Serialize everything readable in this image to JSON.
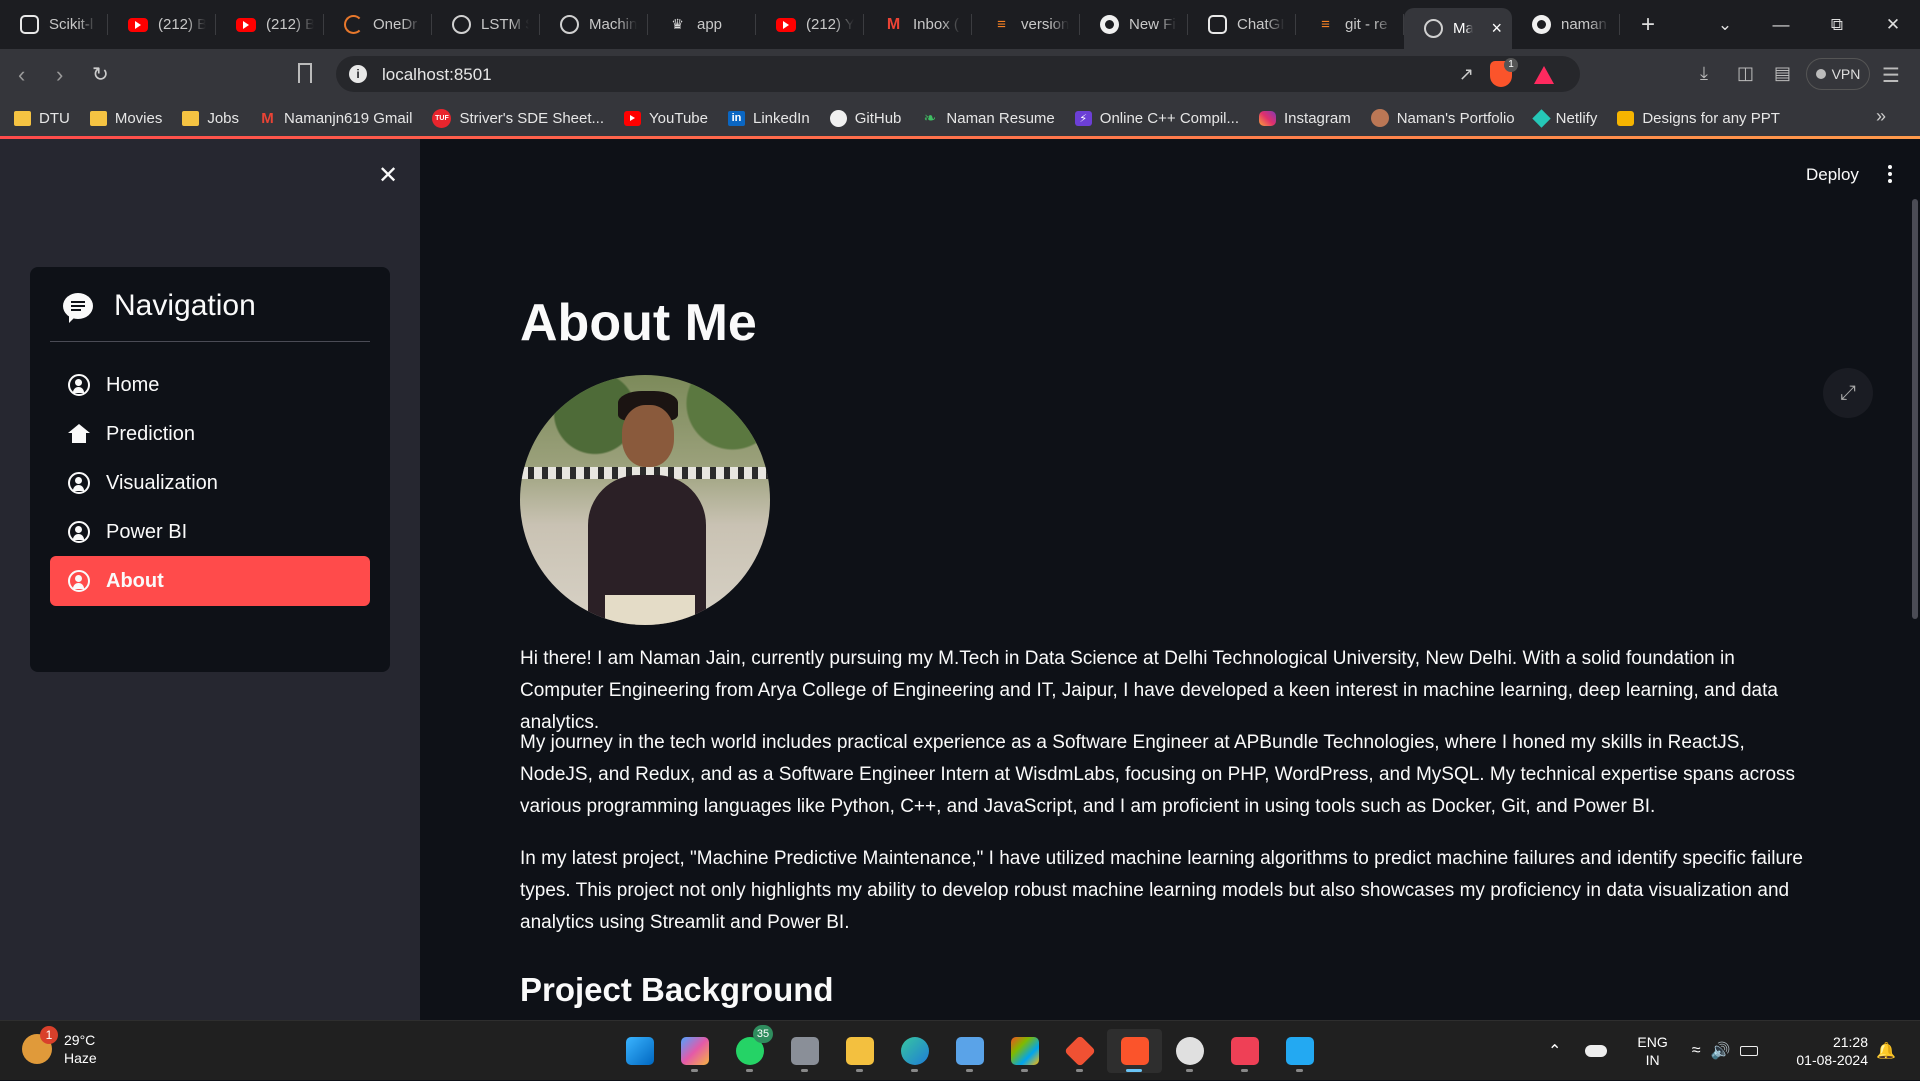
{
  "browser": {
    "tabs": [
      {
        "icon": "openai-icon",
        "label": "Scikit-l"
      },
      {
        "icon": "youtube-icon",
        "label": "(212) B"
      },
      {
        "icon": "youtube-icon",
        "label": "(212) B"
      },
      {
        "icon": "onedrive-icon",
        "label": "OneDr"
      },
      {
        "icon": "globe-icon",
        "label": "LSTM S"
      },
      {
        "icon": "globe-icon",
        "label": "Machin"
      },
      {
        "icon": "streamlit-crown-icon",
        "label": "app"
      },
      {
        "icon": "youtube-icon",
        "label": "(212) Y"
      },
      {
        "icon": "gmail-icon",
        "label": "Inbox ("
      },
      {
        "icon": "stackoverflow-icon",
        "label": "version"
      },
      {
        "icon": "github-icon",
        "label": "New Fi"
      },
      {
        "icon": "openai-icon",
        "label": "ChatGI"
      },
      {
        "icon": "stackoverflow-icon",
        "label": "git - re"
      },
      {
        "icon": "globe-icon",
        "label": "Ma",
        "active": true
      },
      {
        "icon": "github-icon",
        "label": "naman"
      }
    ],
    "new_tab_label": "+",
    "url": "localhost:8501",
    "vpn_label": "VPN",
    "shield_count": "1",
    "bookmarks": [
      {
        "icon": "folder-icon",
        "label": "DTU"
      },
      {
        "icon": "folder-icon",
        "label": "Movies"
      },
      {
        "icon": "folder-icon",
        "label": "Jobs"
      },
      {
        "icon": "gmail-icon",
        "label": "Namanjn619 Gmail"
      },
      {
        "icon": "takeuforward-icon",
        "label": "Striver's SDE Sheet..."
      },
      {
        "icon": "youtube-icon",
        "label": "YouTube"
      },
      {
        "icon": "linkedin-icon",
        "label": "LinkedIn"
      },
      {
        "icon": "github-icon",
        "label": "GitHub"
      },
      {
        "icon": "resume-icon",
        "label": "Naman Resume"
      },
      {
        "icon": "cpp-compiler-icon",
        "label": "Online C++ Compil..."
      },
      {
        "icon": "instagram-icon",
        "label": "Instagram"
      },
      {
        "icon": "portfolio-icon",
        "label": "Naman's Portfolio"
      },
      {
        "icon": "netlify-icon",
        "label": "Netlify"
      },
      {
        "icon": "ppt-folder-icon",
        "label": "Designs for any PPT"
      }
    ]
  },
  "app": {
    "deploy_label": "Deploy",
    "sidebar": {
      "title": "Navigation",
      "items": [
        {
          "label": "Home",
          "icon": "person-circle-icon"
        },
        {
          "label": "Prediction",
          "icon": "house-icon"
        },
        {
          "label": "Visualization",
          "icon": "person-circle-icon"
        },
        {
          "label": "Power BI",
          "icon": "person-circle-icon"
        },
        {
          "label": "About",
          "icon": "person-circle-icon",
          "active": true
        }
      ]
    },
    "main": {
      "title": "About Me",
      "paragraphs": [
        "Hi there! I am Naman Jain, currently pursuing my M.Tech in Data Science at Delhi Technological University, New Delhi. With a solid foundation in Computer Engineering from Arya College of Engineering and IT, Jaipur, I have developed a keen interest in machine learning, deep learning, and data analytics.",
        "My journey in the tech world includes practical experience as a Software Engineer at APBundle Technologies, where I honed my skills in ReactJS, NodeJS, and Redux, and as a Software Engineer Intern at WisdmLabs, focusing on PHP, WordPress, and MySQL. My technical expertise spans across various programming languages like Python, C++, and JavaScript, and I am proficient in using tools such as Docker, Git, and Power BI.",
        "In my latest project, \"Machine Predictive Maintenance,\" I have utilized machine learning algorithms to predict machine failures and identify specific failure types. This project not only highlights my ability to develop robust machine learning models but also showcases my proficiency in data visualization and analytics using Streamlit and Power BI."
      ],
      "section_heading": "Project Background"
    },
    "colors": {
      "accent": "#ff4b4b",
      "sidebar_bg": "#262730",
      "main_bg": "#0e1117"
    }
  },
  "taskbar": {
    "weather": {
      "temp": "29°C",
      "condition": "Haze",
      "badge": "1"
    },
    "apps": [
      {
        "icon": "windows-start-icon"
      },
      {
        "icon": "copilot-icon"
      },
      {
        "icon": "whatsapp-icon",
        "badge": "35"
      },
      {
        "icon": "settings-icon"
      },
      {
        "icon": "file-explorer-icon"
      },
      {
        "icon": "edge-icon"
      },
      {
        "icon": "control-panel-icon"
      },
      {
        "icon": "microsoft-store-icon"
      },
      {
        "icon": "git-icon"
      },
      {
        "icon": "brave-icon",
        "active": true
      },
      {
        "icon": "clock-app-icon"
      },
      {
        "icon": "pocket-icon"
      },
      {
        "icon": "vscode-icon"
      }
    ],
    "lang": "ENG",
    "region": "IN",
    "time": "21:28",
    "date": "01-08-2024"
  }
}
